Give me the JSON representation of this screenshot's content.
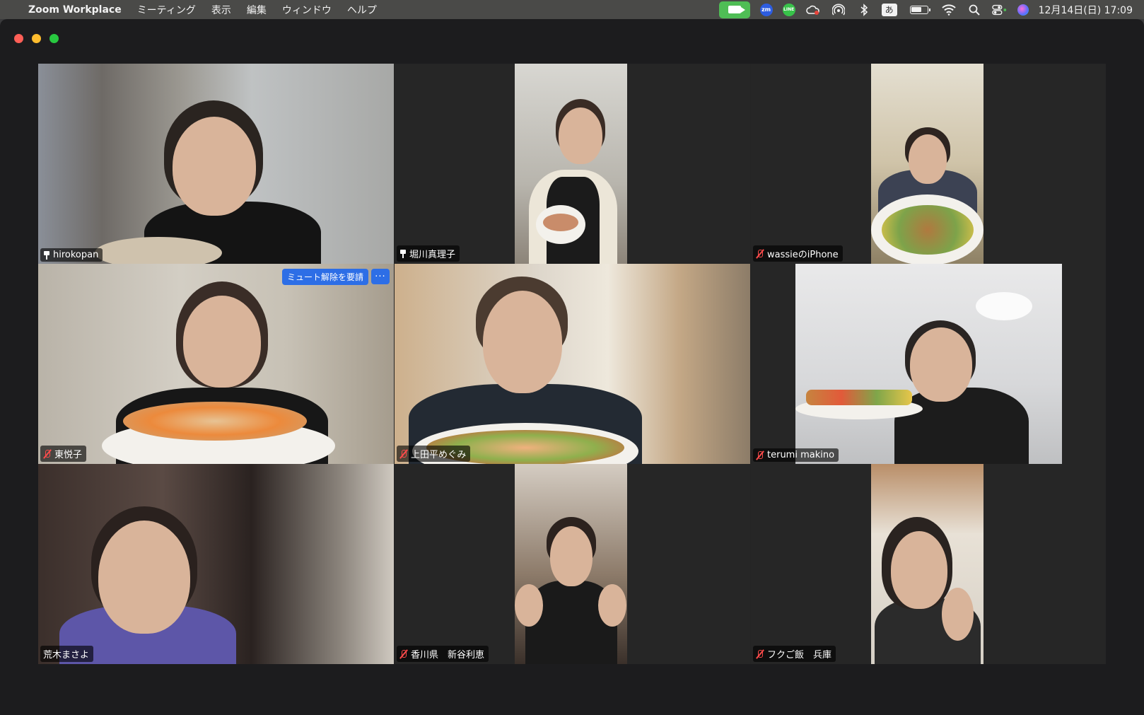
{
  "menubar": {
    "app_name": "Zoom Workplace",
    "menus": [
      "ミーティング",
      "表示",
      "編集",
      "ウィンドウ",
      "ヘルプ"
    ],
    "zm_label": "zm",
    "line_label": "LINE",
    "ime_label": "あ",
    "clock": "12月14日(日) 17:09"
  },
  "gallery": {
    "unmute_request_label": "ミュート解除を要請",
    "more_label": "···",
    "participants": [
      {
        "name": "hirokopan",
        "status": "pinned",
        "active_speaker": true
      },
      {
        "name": "堀川真理子",
        "status": "pinned"
      },
      {
        "name": "wassieのiPhone",
        "status": "muted"
      },
      {
        "name": "東悦子",
        "status": "muted"
      },
      {
        "name": "上田平めぐみ",
        "status": "muted"
      },
      {
        "name": "terumi makino",
        "status": "muted"
      },
      {
        "name": "荒木まさよ",
        "status": "none"
      },
      {
        "name": "香川県　新谷利恵",
        "status": "muted"
      },
      {
        "name": "フクご飯　兵庫",
        "status": "muted"
      }
    ]
  },
  "colors": {
    "active_speaker_border": "#6cc76a",
    "unmute_button": "#2d6ee6",
    "muted_mic": "#ff4b4b",
    "zoom_status": "#4fbd55"
  }
}
